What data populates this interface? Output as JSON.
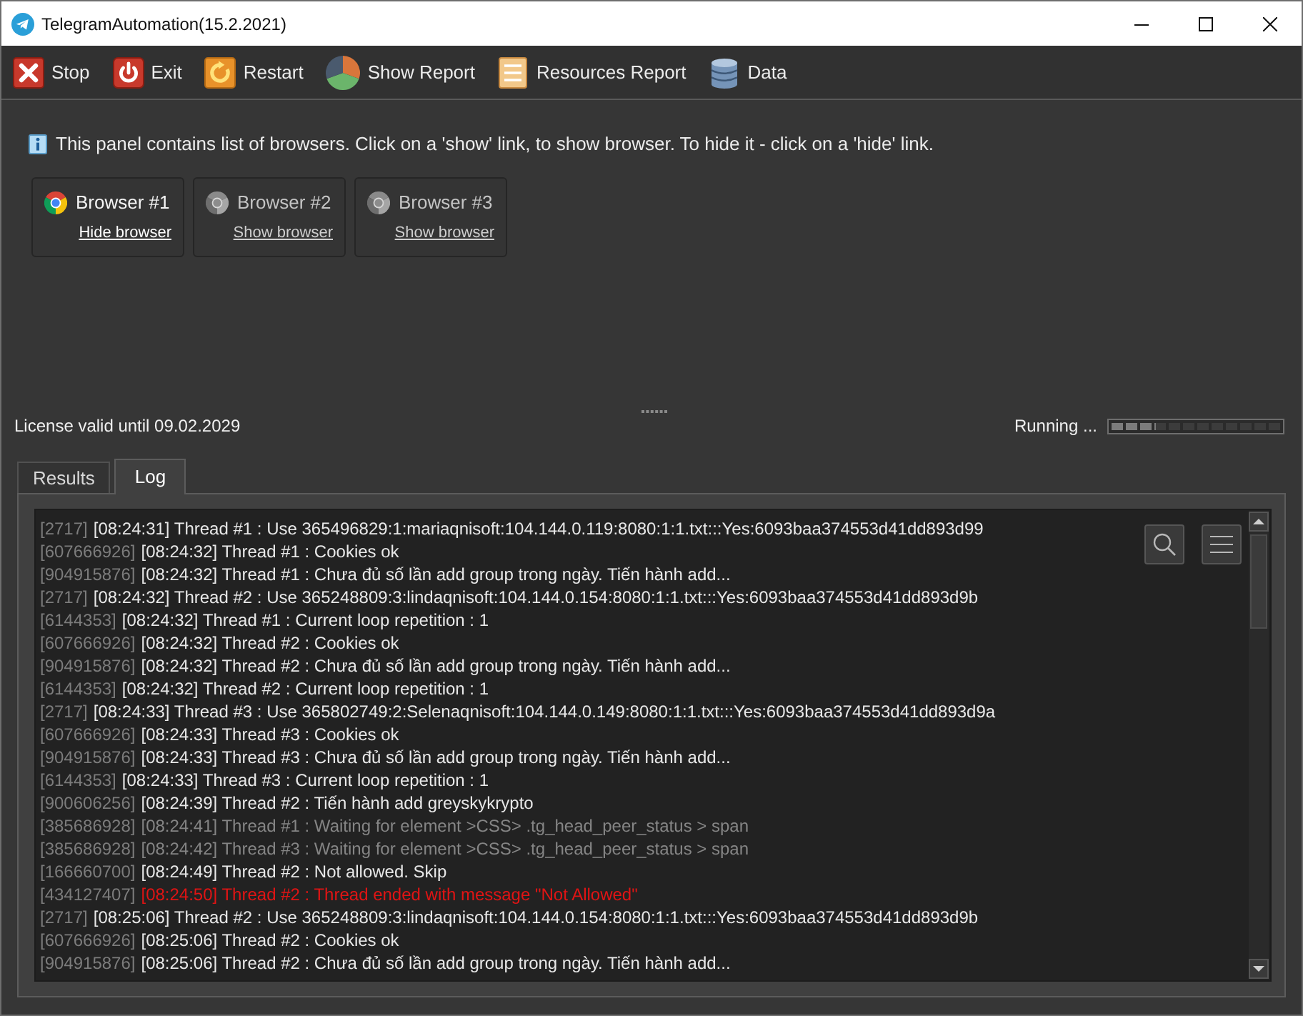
{
  "window": {
    "title": "TelegramAutomation(15.2.2021)"
  },
  "toolbar": [
    {
      "label": "Stop",
      "kind": "stop"
    },
    {
      "label": "Exit",
      "kind": "exit"
    },
    {
      "label": "Restart",
      "kind": "restart"
    },
    {
      "label": "Show Report",
      "kind": "report"
    },
    {
      "label": "Resources Report",
      "kind": "resources"
    },
    {
      "label": "Data",
      "kind": "data"
    }
  ],
  "info": {
    "text": "This panel contains list of browsers. Click on a 'show' link, to show browser. To hide it - click on a 'hide' link."
  },
  "browsers": [
    {
      "name": "Browser #1",
      "link": "Hide browser",
      "shown": true
    },
    {
      "name": "Browser #2",
      "link": "Show browser",
      "shown": false
    },
    {
      "name": "Browser #3",
      "link": "Show browser",
      "shown": false
    }
  ],
  "status_bar": {
    "license": "License valid until 09.02.2029",
    "activity": "Running ...",
    "progress": {
      "level": 0.27
    }
  },
  "tabs": [
    {
      "label": "Results",
      "selected": false
    },
    {
      "label": "Log",
      "selected": true
    }
  ],
  "log": [
    {
      "source": "[2717]",
      "text": "[08:24:31] Thread #1 : Use 365496829:1:mariaqnisoft:104.144.0.119:8080:1:1.txt:::Yes:6093baa374553d41dd893d99",
      "kind": "info"
    },
    {
      "source": "[607666926]",
      "text": "[08:24:32] Thread #1 : Cookies ok",
      "kind": "info"
    },
    {
      "source": "[904915876]",
      "text": "[08:24:32] Thread #1 : Chưa đủ số lần add group trong ngày. Tiến hành add...",
      "kind": "info"
    },
    {
      "source": "[2717]",
      "text": "[08:24:32] Thread #2 : Use 365248809:3:lindaqnisoft:104.144.0.154:8080:1:1.txt:::Yes:6093baa374553d41dd893d9b",
      "kind": "info"
    },
    {
      "source": "[6144353]",
      "text": "[08:24:32] Thread #1 : Current loop repetition : 1",
      "kind": "info"
    },
    {
      "source": "[607666926]",
      "text": "[08:24:32] Thread #2 : Cookies ok",
      "kind": "info"
    },
    {
      "source": "[904915876]",
      "text": "[08:24:32] Thread #2 : Chưa đủ số lần add group trong ngày. Tiến hành add...",
      "kind": "info"
    },
    {
      "source": "[6144353]",
      "text": "[08:24:32] Thread #2 : Current loop repetition : 1",
      "kind": "info"
    },
    {
      "source": "[2717]",
      "text": "[08:24:33] Thread #3 : Use 365802749:2:Selenaqnisoft:104.144.0.149:8080:1:1.txt:::Yes:6093baa374553d41dd893d9a",
      "kind": "info"
    },
    {
      "source": "[607666926]",
      "text": "[08:24:33] Thread #3 : Cookies ok",
      "kind": "info"
    },
    {
      "source": "[904915876]",
      "text": "[08:24:33] Thread #3 : Chưa đủ số lần add group trong ngày. Tiến hành add...",
      "kind": "info"
    },
    {
      "source": "[6144353]",
      "text": "[08:24:33] Thread #3 : Current loop repetition : 1",
      "kind": "info"
    },
    {
      "source": "[900606256]",
      "text": "[08:24:39] Thread #2 : Tiến hành add greyskykrypto",
      "kind": "info"
    },
    {
      "source": "[385686928]",
      "text": "[08:24:41] Thread #1 : Waiting for element >CSS> .tg_head_peer_status > span",
      "kind": "muted"
    },
    {
      "source": "[385686928]",
      "text": "[08:24:42] Thread #3 : Waiting for element >CSS> .tg_head_peer_status > span",
      "kind": "muted"
    },
    {
      "source": "[166660700]",
      "text": "[08:24:49] Thread #2 : Not allowed. Skip",
      "kind": "info"
    },
    {
      "source": "[434127407]",
      "text": "[08:24:50] Thread #2 : Thread ended with message \"Not Allowed\"",
      "kind": "error"
    },
    {
      "source": "[2717]",
      "text": "[08:25:06] Thread #2 : Use 365248809:3:lindaqnisoft:104.144.0.154:8080:1:1.txt:::Yes:6093baa374553d41dd893d9b",
      "kind": "info"
    },
    {
      "source": "[607666926]",
      "text": "[08:25:06] Thread #2 : Cookies ok",
      "kind": "info"
    },
    {
      "source": "[904915876]",
      "text": "[08:25:06] Thread #2 : Chưa đủ số lần add group trong ngày. Tiến hành add...",
      "kind": "info"
    }
  ]
}
